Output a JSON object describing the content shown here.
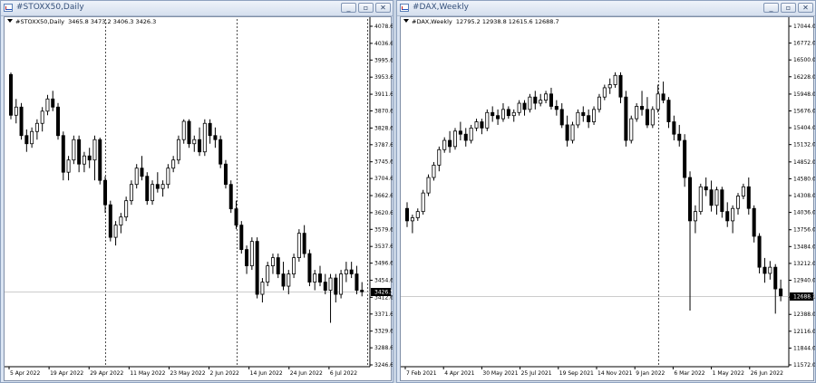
{
  "windows": [
    {
      "id": "stoxx",
      "title": "#STOXX50,Daily",
      "header_symbol": "#STOXX50,Daily",
      "header_ohlc": "3465.8 3473.2 3406.3 3426.3",
      "buttons": {
        "minimize": "_",
        "restore": "▫",
        "close": "✕"
      },
      "chart_data": {
        "type": "candlestick",
        "y_range": [
          3246.6,
          4078.6
        ],
        "y_ticks": [
          "4078.6",
          "4036.6",
          "3995.6",
          "3953.6",
          "3911.6",
          "3870.6",
          "3828.6",
          "3787.6",
          "3745.6",
          "3704.6",
          "3662.6",
          "3620.6",
          "3579.6",
          "3537.6",
          "3496.6",
          "3454.6",
          "3412.6",
          "3371.6",
          "3329.6",
          "3288.6",
          "3246.6"
        ],
        "x_ticks": [
          "5 Apr 2022",
          "19 Apr 2022",
          "29 Apr 2022",
          "11 May 2022",
          "23 May 2022",
          "2 Jun 2022",
          "14 Jun 2022",
          "24 Jun 2022",
          "6 Jul 2022"
        ],
        "period_separator_indices": [
          18,
          43,
          68
        ],
        "current_price": 3426.3,
        "current_price_label": "3426.3",
        "candles": [
          [
            3960,
            3965,
            3850,
            3860
          ],
          [
            3860,
            3900,
            3840,
            3880
          ],
          [
            3880,
            3890,
            3800,
            3810
          ],
          [
            3810,
            3825,
            3770,
            3790
          ],
          [
            3790,
            3830,
            3780,
            3820
          ],
          [
            3820,
            3850,
            3800,
            3840
          ],
          [
            3840,
            3880,
            3820,
            3870
          ],
          [
            3870,
            3910,
            3860,
            3900
          ],
          [
            3900,
            3920,
            3870,
            3880
          ],
          [
            3880,
            3890,
            3800,
            3810
          ],
          [
            3810,
            3820,
            3700,
            3720
          ],
          [
            3720,
            3760,
            3700,
            3750
          ],
          [
            3750,
            3810,
            3740,
            3800
          ],
          [
            3800,
            3810,
            3720,
            3740
          ],
          [
            3740,
            3770,
            3720,
            3760
          ],
          [
            3760,
            3780,
            3730,
            3750
          ],
          [
            3750,
            3810,
            3700,
            3800
          ],
          [
            3800,
            3805,
            3690,
            3700
          ],
          [
            3700,
            3710,
            3620,
            3640
          ],
          [
            3640,
            3650,
            3550,
            3560
          ],
          [
            3560,
            3600,
            3540,
            3590
          ],
          [
            3590,
            3620,
            3570,
            3610
          ],
          [
            3610,
            3660,
            3600,
            3650
          ],
          [
            3650,
            3700,
            3640,
            3690
          ],
          [
            3690,
            3740,
            3680,
            3730
          ],
          [
            3730,
            3760,
            3700,
            3710
          ],
          [
            3710,
            3720,
            3640,
            3650
          ],
          [
            3650,
            3700,
            3640,
            3690
          ],
          [
            3690,
            3720,
            3670,
            3680
          ],
          [
            3680,
            3700,
            3660,
            3690
          ],
          [
            3690,
            3740,
            3680,
            3730
          ],
          [
            3730,
            3760,
            3720,
            3750
          ],
          [
            3750,
            3810,
            3740,
            3800
          ],
          [
            3800,
            3850,
            3790,
            3845
          ],
          [
            3845,
            3850,
            3780,
            3790
          ],
          [
            3790,
            3810,
            3770,
            3800
          ],
          [
            3800,
            3830,
            3760,
            3770
          ],
          [
            3770,
            3850,
            3760,
            3840
          ],
          [
            3840,
            3850,
            3790,
            3810
          ],
          [
            3810,
            3830,
            3780,
            3800
          ],
          [
            3800,
            3810,
            3730,
            3740
          ],
          [
            3740,
            3750,
            3680,
            3690
          ],
          [
            3690,
            3700,
            3620,
            3630
          ],
          [
            3630,
            3650,
            3580,
            3590
          ],
          [
            3590,
            3600,
            3520,
            3530
          ],
          [
            3530,
            3540,
            3470,
            3490
          ],
          [
            3490,
            3560,
            3480,
            3550
          ],
          [
            3550,
            3560,
            3410,
            3420
          ],
          [
            3420,
            3460,
            3400,
            3450
          ],
          [
            3450,
            3500,
            3440,
            3490
          ],
          [
            3490,
            3520,
            3470,
            3510
          ],
          [
            3510,
            3520,
            3460,
            3470
          ],
          [
            3470,
            3500,
            3430,
            3440
          ],
          [
            3440,
            3480,
            3420,
            3470
          ],
          [
            3470,
            3520,
            3460,
            3510
          ],
          [
            3510,
            3580,
            3500,
            3570
          ],
          [
            3570,
            3590,
            3510,
            3520
          ],
          [
            3520,
            3530,
            3440,
            3450
          ],
          [
            3450,
            3480,
            3430,
            3470
          ],
          [
            3470,
            3490,
            3440,
            3450
          ],
          [
            3450,
            3470,
            3420,
            3430
          ],
          [
            3430,
            3470,
            3350,
            3460
          ],
          [
            3460,
            3470,
            3400,
            3420
          ],
          [
            3420,
            3480,
            3410,
            3470
          ],
          [
            3470,
            3500,
            3450,
            3480
          ],
          [
            3480,
            3500,
            3460,
            3470
          ],
          [
            3470,
            3490,
            3420,
            3430
          ],
          [
            3430,
            3450,
            3415,
            3426.3
          ]
        ]
      }
    },
    {
      "id": "dax",
      "title": "#DAX,Weekly",
      "header_symbol": "#DAX,Weekly",
      "header_ohlc": "12795.2 12938.8 12615.6 12688.7",
      "buttons": {
        "minimize": "_",
        "restore": "▫",
        "close": "✕"
      },
      "chart_data": {
        "type": "candlestick",
        "y_range": [
          11572.0,
          17044.0
        ],
        "y_ticks": [
          "17044.0",
          "16772.0",
          "16500.0",
          "16228.0",
          "15948.0",
          "15676.0",
          "15404.0",
          "15132.0",
          "14852.0",
          "14580.0",
          "14308.0",
          "14036.0",
          "13756.0",
          "13484.0",
          "13212.0",
          "12940.0",
          "12668.0",
          "12388.0",
          "12116.0",
          "11844.0",
          "11572.0"
        ],
        "x_ticks": [
          "7 Feb 2021",
          "4 Apr 2021",
          "30 May 2021",
          "25 Jul 2021",
          "19 Sep 2021",
          "14 Nov 2021",
          "9 Jan 2022",
          "6 Mar 2022",
          "1 May 2022",
          "26 Jun 2022"
        ],
        "period_separator_indices": [
          47
        ],
        "current_price": 12688.7,
        "current_price_label": "12688.7",
        "candles": [
          [
            14100,
            14200,
            13800,
            13900
          ],
          [
            13900,
            14000,
            13700,
            13950
          ],
          [
            13950,
            14100,
            13900,
            14050
          ],
          [
            14050,
            14400,
            14000,
            14350
          ],
          [
            14350,
            14650,
            14300,
            14600
          ],
          [
            14600,
            14850,
            14550,
            14800
          ],
          [
            14800,
            15100,
            14700,
            15050
          ],
          [
            15050,
            15250,
            15000,
            15200
          ],
          [
            15200,
            15350,
            15000,
            15100
          ],
          [
            15100,
            15400,
            15050,
            15350
          ],
          [
            15350,
            15500,
            15200,
            15300
          ],
          [
            15300,
            15400,
            15100,
            15200
          ],
          [
            15200,
            15450,
            15150,
            15400
          ],
          [
            15400,
            15550,
            15350,
            15500
          ],
          [
            15500,
            15550,
            15300,
            15400
          ],
          [
            15400,
            15700,
            15350,
            15650
          ],
          [
            15650,
            15750,
            15500,
            15600
          ],
          [
            15600,
            15700,
            15450,
            15550
          ],
          [
            15550,
            15800,
            15500,
            15700
          ],
          [
            15700,
            15750,
            15550,
            15600
          ],
          [
            15600,
            15700,
            15500,
            15650
          ],
          [
            15650,
            15850,
            15600,
            15800
          ],
          [
            15800,
            15850,
            15600,
            15700
          ],
          [
            15700,
            15950,
            15650,
            15900
          ],
          [
            15900,
            16000,
            15700,
            15800
          ],
          [
            15800,
            15950,
            15750,
            15850
          ],
          [
            15850,
            16000,
            15800,
            15950
          ],
          [
            15950,
            16050,
            15700,
            15750
          ],
          [
            15750,
            15850,
            15600,
            15700
          ],
          [
            15700,
            15800,
            15400,
            15450
          ],
          [
            15450,
            15600,
            15100,
            15200
          ],
          [
            15200,
            15500,
            15150,
            15450
          ],
          [
            15450,
            15700,
            15400,
            15650
          ],
          [
            15650,
            15750,
            15500,
            15600
          ],
          [
            15600,
            15700,
            15400,
            15500
          ],
          [
            15500,
            15750,
            15450,
            15700
          ],
          [
            15700,
            15950,
            15650,
            15900
          ],
          [
            15900,
            16100,
            15850,
            16050
          ],
          [
            16050,
            16200,
            15950,
            16100
          ],
          [
            16100,
            16300,
            16050,
            16250
          ],
          [
            16250,
            16300,
            15800,
            15900
          ],
          [
            15900,
            16000,
            15100,
            15200
          ],
          [
            15200,
            15600,
            15150,
            15550
          ],
          [
            15550,
            15800,
            15500,
            15750
          ],
          [
            15750,
            16000,
            15600,
            15700
          ],
          [
            15700,
            15900,
            15400,
            15450
          ],
          [
            15450,
            15750,
            15400,
            15700
          ],
          [
            15700,
            16100,
            15650,
            15950
          ],
          [
            15950,
            16150,
            15800,
            15850
          ],
          [
            15850,
            15900,
            15400,
            15500
          ],
          [
            15500,
            15600,
            15200,
            15300
          ],
          [
            15300,
            15450,
            15100,
            15200
          ],
          [
            15200,
            15300,
            14450,
            14600
          ],
          [
            14600,
            14700,
            12450,
            13900
          ],
          [
            13900,
            14150,
            13700,
            14050
          ],
          [
            14050,
            14500,
            14000,
            14450
          ],
          [
            14450,
            14600,
            14300,
            14400
          ],
          [
            14400,
            14550,
            14050,
            14150
          ],
          [
            14150,
            14450,
            14000,
            14400
          ],
          [
            14400,
            14450,
            13950,
            14050
          ],
          [
            14050,
            14200,
            13800,
            13900
          ],
          [
            13900,
            14150,
            13700,
            14100
          ],
          [
            14100,
            14350,
            14000,
            14300
          ],
          [
            14300,
            14500,
            14250,
            14450
          ],
          [
            14450,
            14600,
            14000,
            14100
          ],
          [
            14100,
            14150,
            13550,
            13650
          ],
          [
            13650,
            13700,
            13050,
            13150
          ],
          [
            13150,
            13300,
            12900,
            13050
          ],
          [
            13050,
            13250,
            12950,
            13150
          ],
          [
            13150,
            13200,
            12400,
            12800
          ],
          [
            12800,
            12950,
            12600,
            12688.7
          ]
        ]
      }
    }
  ]
}
